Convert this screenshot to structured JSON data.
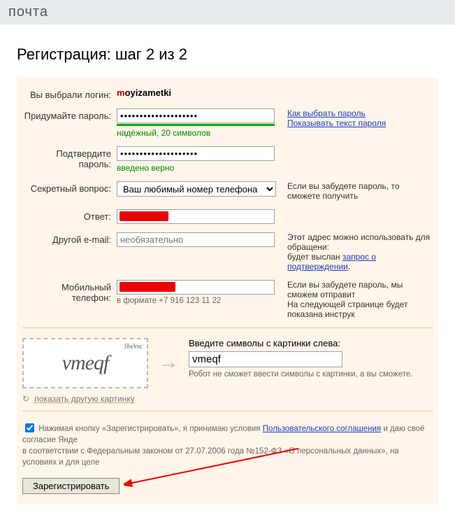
{
  "topbar": {
    "title": "почта"
  },
  "heading": "Регистрация: шаг 2 из 2",
  "labels": {
    "login": "Вы выбрали логин:",
    "password": "Придумайте пароль:",
    "confirm": "Подтвердите пароль:",
    "secret_q": "Секретный вопрос:",
    "answer": "Ответ:",
    "other_email": "Другой e-mail:",
    "phone": "Мобильный телефон:"
  },
  "login": {
    "first_char": "m",
    "rest": "oyizametki"
  },
  "password": {
    "masked": "●●●●●●●●●●●●●●●●●●●●",
    "strength": "надёжный, 20 символов",
    "how_to_choose": "Как выбрать пароль",
    "show_text": "Показывать текст пароля"
  },
  "confirm": {
    "masked": "●●●●●●●●●●●●●●●●●●●●",
    "ok": "введено верно"
  },
  "secret": {
    "selected": "Ваш любимый номер телефона",
    "side": "Если вы забудете пароль, то сможете получить"
  },
  "answer": {
    "value": ""
  },
  "other_email": {
    "placeholder": "необязательно",
    "side1": "Этот адрес можно использовать для обращени:",
    "side2_pre": "будет выслан ",
    "side2_link": "запрос о подтверждении",
    "side2_post": "."
  },
  "phone": {
    "value": "",
    "hint": "в формате +7 916 123 11 22",
    "side1": "Если вы забудете пароль, мы сможем отправит",
    "side2": "На следующей странице будет показана инструк"
  },
  "captcha": {
    "text": "vmeqf",
    "brand": "Яндекс",
    "label": "Введите символы с картинки слева:",
    "input": "vmeqf",
    "hint": "Робот не сможет ввести символы с картинки, а вы сможете.",
    "refresh": "показать другую картинку"
  },
  "agree": {
    "text1": "Нажимая кнопку «Зарегистрировать», я принимаю условия ",
    "link": "Пользовательского соглашения",
    "text2": " и даю своё согласие Янде",
    "text3": "в соответствии с Федеральным законом от 27.07.2006 года №152-ФЗ «О персональных данных», на условиях и для целе"
  },
  "submit": {
    "label": "Зарегистрировать"
  }
}
